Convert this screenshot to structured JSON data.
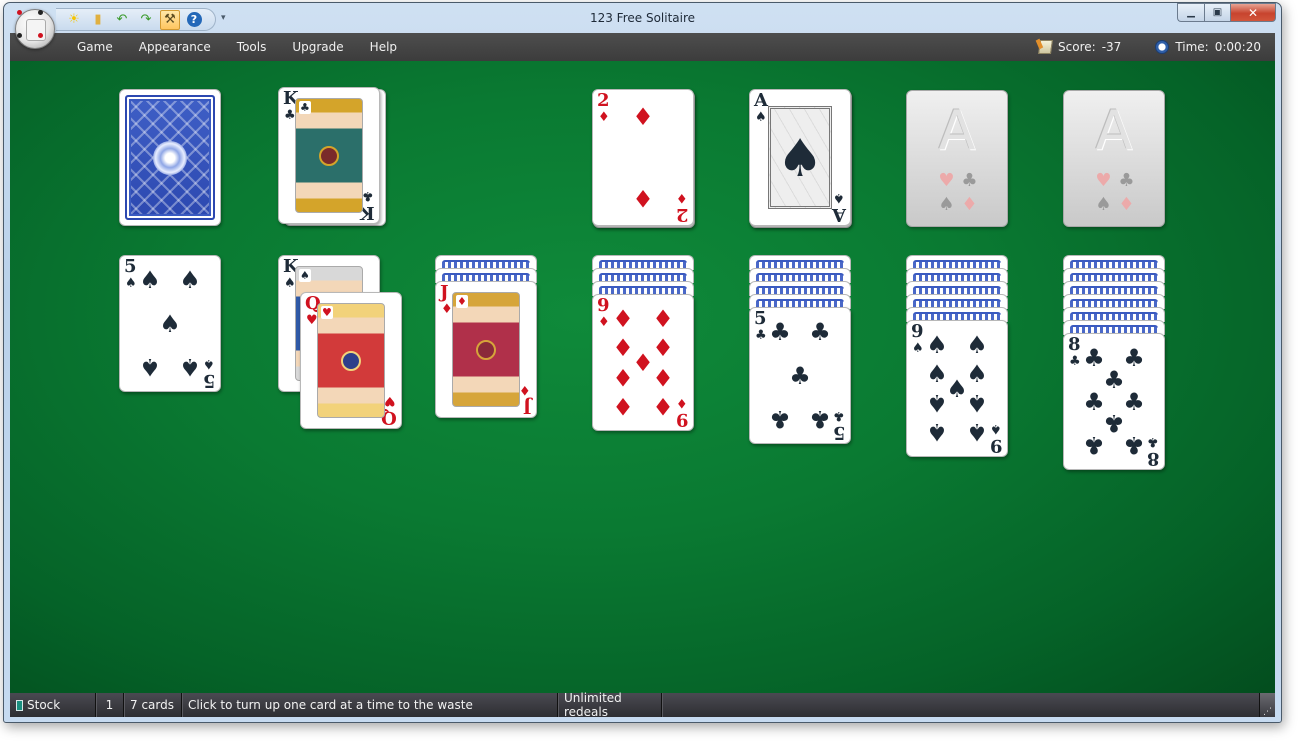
{
  "window": {
    "title": "123 Free Solitaire",
    "controls": {
      "minimize": "minimize",
      "maximize": "maximize",
      "close": "close"
    }
  },
  "quick_access_toolbar": [
    {
      "name": "new-game-icon",
      "glyph": "☀",
      "color": "#f5c400",
      "active": false
    },
    {
      "name": "open-folder-icon",
      "glyph": "▮",
      "color": "#e0b040",
      "active": false
    },
    {
      "name": "undo-icon",
      "glyph": "↶",
      "color": "#3a9a2a",
      "active": false
    },
    {
      "name": "redo-icon",
      "glyph": "↷",
      "color": "#3a9a2a",
      "active": false
    },
    {
      "name": "hint-wand-icon",
      "glyph": "⚒",
      "color": "#5a4a20",
      "active": true
    },
    {
      "name": "help-icon",
      "glyph": "?",
      "color": "#ffffff",
      "active": false
    }
  ],
  "menu": {
    "items": [
      "Game",
      "Appearance",
      "Tools",
      "Upgrade",
      "Help"
    ],
    "score_label": "Score:",
    "score_value": "-37",
    "time_label": "Time:",
    "time_value": "0:00:20"
  },
  "game": {
    "stock": {
      "card_count": 7,
      "face": "back"
    },
    "waste": {
      "top": {
        "rank": "K",
        "suit": "♣",
        "color": "black",
        "face_card": true
      }
    },
    "foundations": [
      {
        "top": {
          "rank": "2",
          "suit": "♦",
          "color": "red"
        }
      },
      {
        "top": {
          "rank": "A",
          "suit": "♠",
          "color": "black"
        }
      },
      {
        "top": null,
        "placeholder": "A"
      },
      {
        "top": null,
        "placeholder": "A"
      }
    ],
    "tableau": [
      {
        "hidden": 0,
        "visible": [
          {
            "rank": "5",
            "suit": "♠",
            "color": "black"
          }
        ]
      },
      {
        "hidden": 0,
        "visible": [
          {
            "rank": "K",
            "suit": "♠",
            "color": "black"
          },
          {
            "rank": "Q",
            "suit": "♥",
            "color": "red"
          }
        ]
      },
      {
        "hidden": 2,
        "visible": [
          {
            "rank": "J",
            "suit": "♦",
            "color": "red"
          }
        ]
      },
      {
        "hidden": 3,
        "visible": [
          {
            "rank": "9",
            "suit": "♦",
            "color": "red"
          }
        ]
      },
      {
        "hidden": 4,
        "visible": [
          {
            "rank": "5",
            "suit": "♣",
            "color": "black"
          }
        ]
      },
      {
        "hidden": 5,
        "visible": [
          {
            "rank": "9",
            "suit": "♠",
            "color": "black"
          }
        ]
      },
      {
        "hidden": 6,
        "visible": [
          {
            "rank": "8",
            "suit": "♣",
            "color": "black"
          }
        ]
      }
    ],
    "placeholder_suits": [
      "♥",
      "♣",
      "♠",
      "♦"
    ]
  },
  "statusbar": {
    "pile": "Stock",
    "index": "1",
    "count": "7 cards",
    "hint": "Click to turn up one card at a time to the waste",
    "redeals": "Unlimited redeals"
  }
}
